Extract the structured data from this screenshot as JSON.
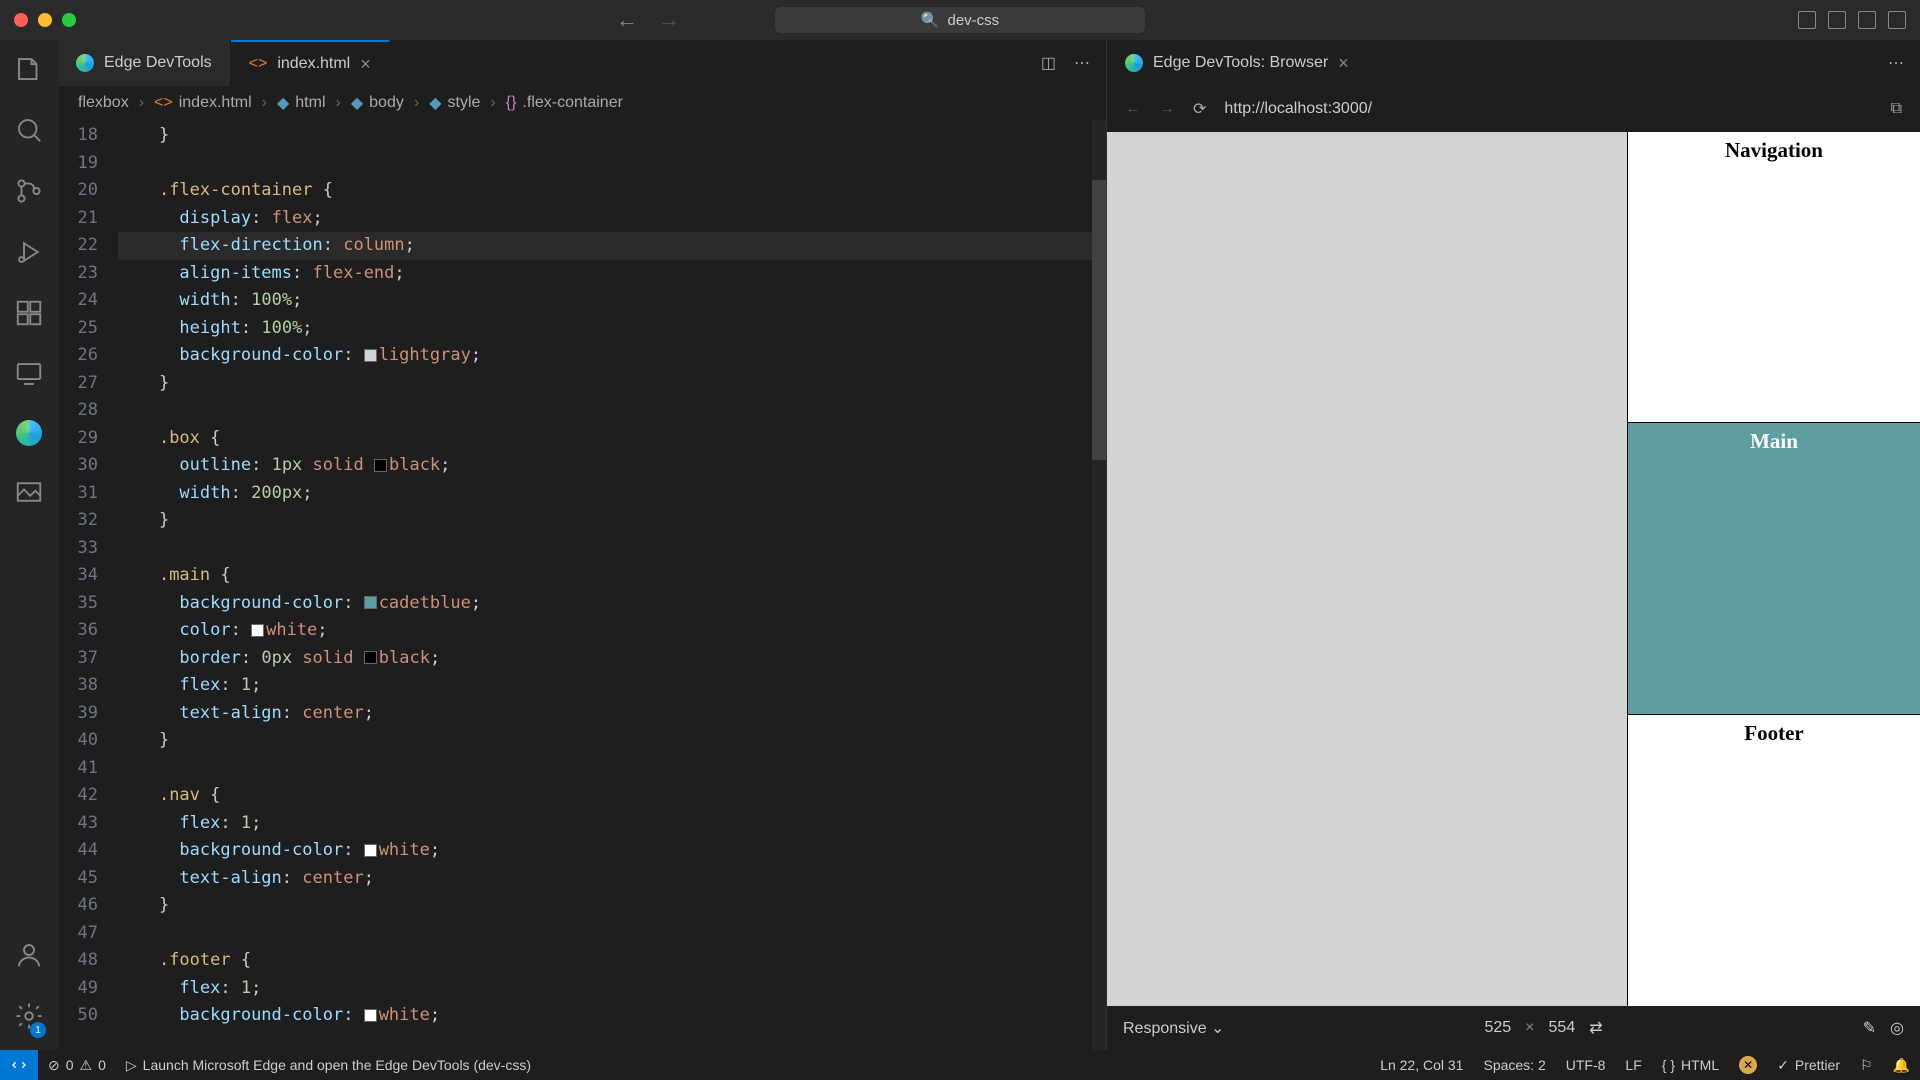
{
  "titlebar": {
    "project": "dev-css"
  },
  "tabs": {
    "left": [
      {
        "label": "Edge DevTools",
        "active": false,
        "icon": "edge"
      },
      {
        "label": "index.html",
        "active": true,
        "icon": "html",
        "modified": false
      }
    ],
    "right": [
      {
        "label": "Edge DevTools: Browser",
        "active": true,
        "icon": "edge"
      }
    ]
  },
  "breadcrumbs": [
    "flexbox",
    "index.html",
    "html",
    "body",
    "style",
    ".flex-container"
  ],
  "gutter_start": 18,
  "code": [
    {
      "n": 18,
      "html": "    <span class='punc'>}</span>"
    },
    {
      "n": 19,
      "html": ""
    },
    {
      "n": 20,
      "html": "    <span class='sel'>.flex-container</span> <span class='punc'>{</span>"
    },
    {
      "n": 21,
      "html": "      <span class='prop'>display</span><span class='punc'>:</span> <span class='val'>flex</span><span class='punc'>;</span>"
    },
    {
      "n": 22,
      "html": "      <span class='prop'>flex-direction</span><span class='punc'>:</span> <span class='val'>column</span><span class='punc'>;</span>",
      "hl": true
    },
    {
      "n": 23,
      "html": "      <span class='prop'>align-items</span><span class='punc'>:</span> <span class='val'>flex-end</span><span class='punc'>;</span>"
    },
    {
      "n": 24,
      "html": "      <span class='prop'>width</span><span class='punc'>:</span> <span class='num'>100%</span><span class='punc'>;</span>"
    },
    {
      "n": 25,
      "html": "      <span class='prop'>height</span><span class='punc'>:</span> <span class='num'>100%</span><span class='punc'>;</span>"
    },
    {
      "n": 26,
      "html": "      <span class='prop'>background-color</span><span class='punc'>:</span> <span class='swatch' style='background:lightgray'></span><span class='val'>lightgray</span><span class='punc'>;</span>"
    },
    {
      "n": 27,
      "html": "    <span class='punc'>}</span>"
    },
    {
      "n": 28,
      "html": ""
    },
    {
      "n": 29,
      "html": "    <span class='sel'>.box</span> <span class='punc'>{</span>"
    },
    {
      "n": 30,
      "html": "      <span class='prop'>outline</span><span class='punc'>:</span> <span class='num'>1px</span> <span class='val'>solid</span> <span class='swatch' style='background:#000'></span><span class='val'>black</span><span class='punc'>;</span>"
    },
    {
      "n": 31,
      "html": "      <span class='prop'>width</span><span class='punc'>:</span> <span class='num'>200px</span><span class='punc'>;</span>"
    },
    {
      "n": 32,
      "html": "    <span class='punc'>}</span>"
    },
    {
      "n": 33,
      "html": ""
    },
    {
      "n": 34,
      "html": "    <span class='sel'>.main</span> <span class='punc'>{</span>"
    },
    {
      "n": 35,
      "html": "      <span class='prop'>background-color</span><span class='punc'>:</span> <span class='swatch' style='background:cadetblue'></span><span class='val'>cadetblue</span><span class='punc'>;</span>"
    },
    {
      "n": 36,
      "html": "      <span class='prop'>color</span><span class='punc'>:</span> <span class='swatch' style='background:#fff'></span><span class='val'>white</span><span class='punc'>;</span>"
    },
    {
      "n": 37,
      "html": "      <span class='prop'>border</span><span class='punc'>:</span> <span class='num'>0px</span> <span class='val'>solid</span> <span class='swatch' style='background:#000'></span><span class='val'>black</span><span class='punc'>;</span>"
    },
    {
      "n": 38,
      "html": "      <span class='prop'>flex</span><span class='punc'>:</span> <span class='num'>1</span><span class='punc'>;</span>"
    },
    {
      "n": 39,
      "html": "      <span class='prop'>text-align</span><span class='punc'>:</span> <span class='val'>center</span><span class='punc'>;</span>"
    },
    {
      "n": 40,
      "html": "    <span class='punc'>}</span>"
    },
    {
      "n": 41,
      "html": ""
    },
    {
      "n": 42,
      "html": "    <span class='sel'>.nav</span> <span class='punc'>{</span>"
    },
    {
      "n": 43,
      "html": "      <span class='prop'>flex</span><span class='punc'>:</span> <span class='num'>1</span><span class='punc'>;</span>"
    },
    {
      "n": 44,
      "html": "      <span class='prop'>background-color</span><span class='punc'>:</span> <span class='swatch' style='background:#fff'></span><span class='val'>white</span><span class='punc'>;</span>"
    },
    {
      "n": 45,
      "html": "      <span class='prop'>text-align</span><span class='punc'>:</span> <span class='val'>center</span><span class='punc'>;</span>"
    },
    {
      "n": 46,
      "html": "    <span class='punc'>}</span>"
    },
    {
      "n": 47,
      "html": ""
    },
    {
      "n": 48,
      "html": "    <span class='sel'>.footer</span> <span class='punc'>{</span>"
    },
    {
      "n": 49,
      "html": "      <span class='prop'>flex</span><span class='punc'>:</span> <span class='num'>1</span><span class='punc'>;</span>"
    },
    {
      "n": 50,
      "html": "      <span class='prop'>background-color</span><span class='punc'>:</span> <span class='swatch' style='background:#fff'></span><span class='val'>white</span><span class='punc'>;</span>"
    }
  ],
  "browser": {
    "url": "http://localhost:3000/",
    "nav_label": "Navigation",
    "main_label": "Main",
    "footer_label": "Footer",
    "responsive_label": "Responsive",
    "width": "525",
    "height": "554"
  },
  "statusbar": {
    "errors": "0",
    "warnings": "0",
    "launch": "Launch Microsoft Edge and open the Edge DevTools (dev-css)",
    "pos": "Ln 22, Col 31",
    "spaces": "Spaces: 2",
    "encoding": "UTF-8",
    "eol": "LF",
    "lang": "HTML",
    "prettier": "Prettier",
    "gear_badge": "1"
  }
}
